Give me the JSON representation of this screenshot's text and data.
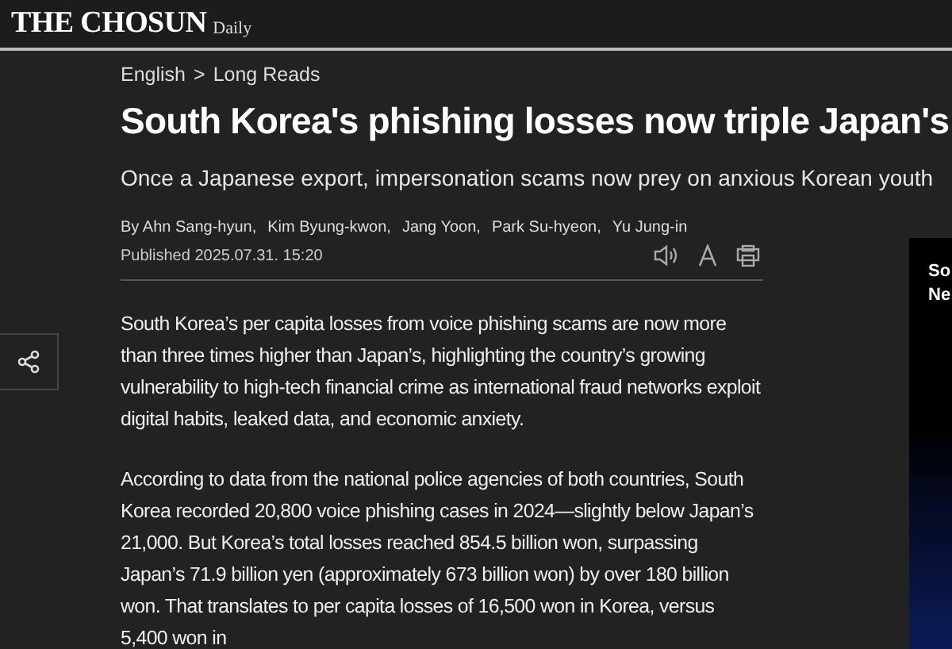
{
  "header": {
    "logo": "THE CHOSUN",
    "logo_suffix": "Daily"
  },
  "breadcrumb": [
    {
      "label": "English"
    },
    {
      "label": "Long Reads"
    }
  ],
  "breadcrumb_separator": ">",
  "article": {
    "title": "South Korea's phishing losses now triple Japan's",
    "subtitle": "Once a Japanese export, impersonation scams now prey on anxious Korean youth",
    "authors": [
      "By Ahn Sang-hyun,",
      "Kim Byung-kwon,",
      "Jang Yoon,",
      "Park Su-hyeon,",
      "Yu Jung-in"
    ],
    "published": "Published 2025.07.31. 15:20",
    "paragraphs": [
      "South Korea’s per capita losses from voice phishing scams are now more than three times higher than Japan’s, highlighting the country’s growing vulnerability to high-tech financial crime as international fraud networks exploit digital habits, leaked data, and economic anxiety.",
      "According to data from the national police agencies of both countries, South Korea recorded 20,800 voice phishing cases in 2024—slightly below Japan’s 21,000. But Korea’s total losses reached 854.5 billion won, surpassing Japan’s 71.9 billion yen (approximately 673 billion won) by over 180 billion won. That translates to per capita losses of 16,500 won in Korea, versus 5,400 won in"
    ]
  },
  "ad": {
    "lines": [
      "So",
      "Ne"
    ]
  }
}
